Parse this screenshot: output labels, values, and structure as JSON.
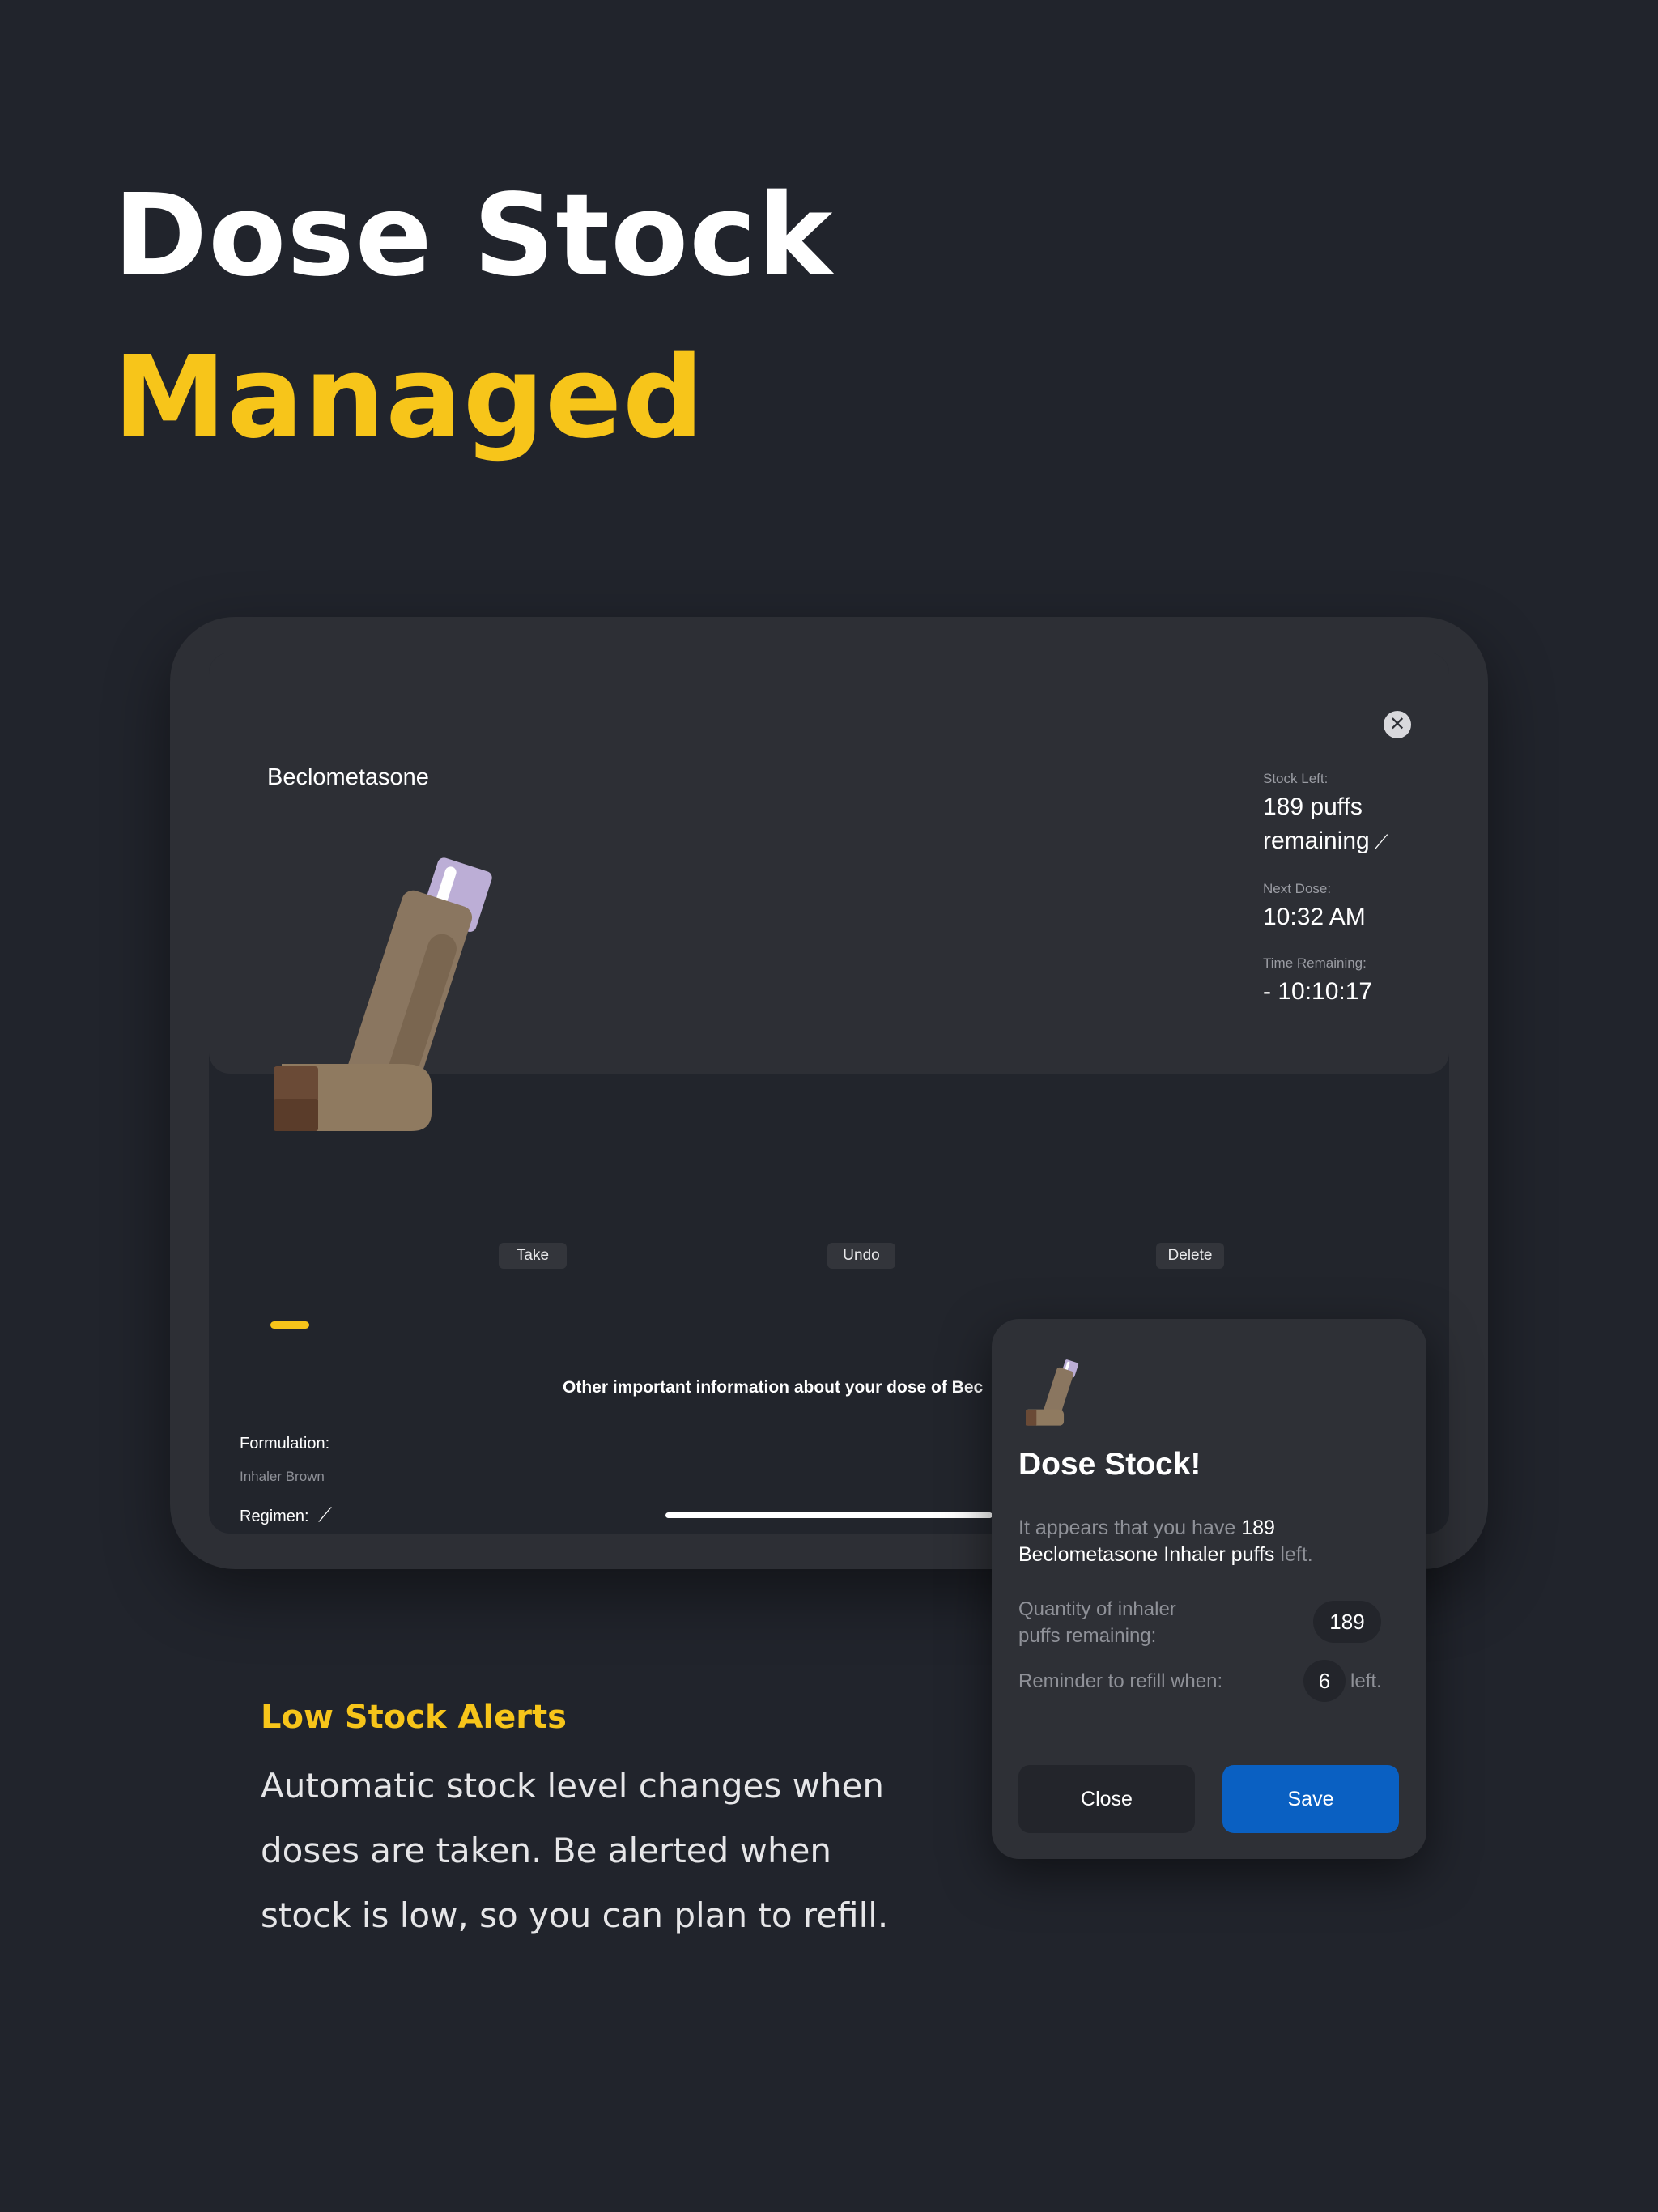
{
  "headline": {
    "line1": "Dose Stock",
    "line2": "Managed"
  },
  "colors": {
    "background": "#21242c",
    "accent_yellow": "#f7c51a",
    "save_blue": "#0a60c2"
  },
  "card": {
    "close_icon": "close-icon",
    "medication_name": "Beclometasone",
    "stock_left_label": "Stock Left:",
    "stock_left_value_line1": "189 puffs",
    "stock_left_value_line2": "remaining",
    "edit_icon": "pencil-icon",
    "next_dose_label": "Next Dose:",
    "next_dose_value": "10:32 AM",
    "time_remaining_label": "Time Remaining:",
    "time_remaining_value": "- 10:10:17"
  },
  "actions": {
    "take": "Take",
    "undo": "Undo",
    "delete": "Delete"
  },
  "info": {
    "title": "Other important information about your dose of Bec",
    "formulation_label": "Formulation:",
    "formulation_value": "Inhaler Brown",
    "regimen_label": "Regimen:"
  },
  "modal": {
    "title": "Dose Stock!",
    "message_pre": "It appears that you have ",
    "message_highlight": "189 Beclometasone Inhaler puffs",
    "message_post": " left.",
    "quantity_label": "Quantity of inhaler puffs remaining:",
    "quantity_value": "189",
    "reminder_label": "Reminder to refill when:",
    "reminder_value": "6",
    "reminder_suffix": "left.",
    "close_button": "Close",
    "save_button": "Save"
  },
  "feature": {
    "title": "Low Stock Alerts",
    "description": "Automatic stock level changes when doses are taken. Be alerted when stock is low, so you can plan to refill."
  }
}
